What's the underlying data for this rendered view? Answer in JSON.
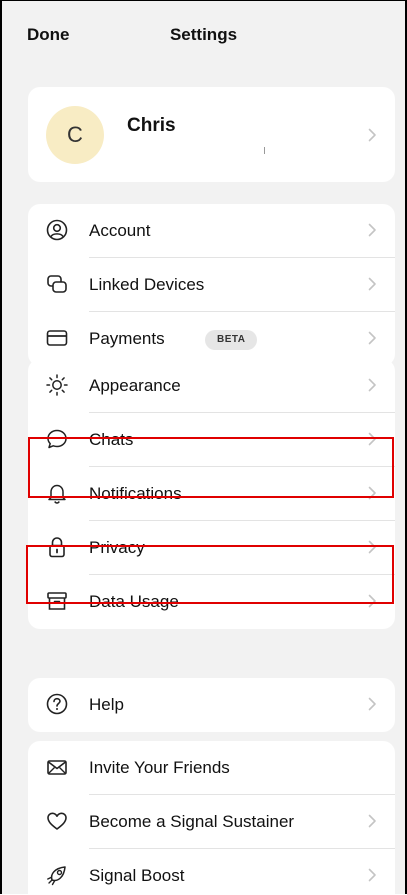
{
  "navbar": {
    "done_label": "Done",
    "title": "Settings"
  },
  "profile": {
    "initial": "C",
    "name": "Chris",
    "avatar_color": "#f8ecc4"
  },
  "groups": {
    "account": [
      {
        "label": "Account",
        "icon": "person-circle-icon"
      },
      {
        "label": "Linked Devices",
        "icon": "linked-devices-icon"
      },
      {
        "label": "Payments",
        "icon": "credit-card-icon",
        "badge": "BETA"
      }
    ],
    "prefs": [
      {
        "label": "Appearance",
        "icon": "sun-icon"
      },
      {
        "label": "Chats",
        "icon": "chat-bubble-icon"
      },
      {
        "label": "Notifications",
        "icon": "bell-icon"
      },
      {
        "label": "Privacy",
        "icon": "lock-icon"
      },
      {
        "label": "Data Usage",
        "icon": "archive-box-icon"
      }
    ],
    "help": [
      {
        "label": "Help",
        "icon": "question-circle-icon"
      }
    ],
    "more": [
      {
        "label": "Invite Your Friends",
        "icon": "envelope-icon"
      },
      {
        "label": "Become a Signal Sustainer",
        "icon": "heart-icon"
      },
      {
        "label": "Signal Boost",
        "icon": "boost-icon"
      }
    ]
  },
  "colors": {
    "highlight": "#e00000",
    "background": "#f2f2f2"
  }
}
